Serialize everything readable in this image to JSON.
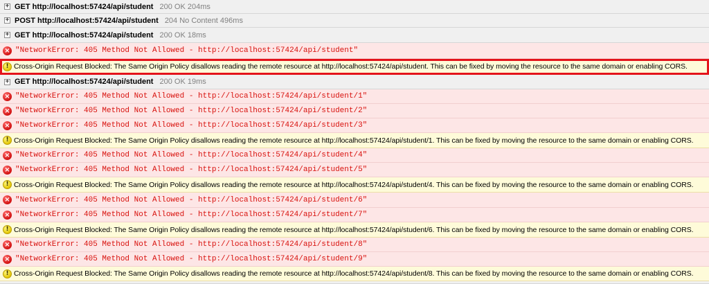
{
  "colors": {
    "network_row_bg": "#f0f0f0",
    "error_row_bg": "#fde6e6",
    "error_text": "#d8100c",
    "warning_row_bg": "#fefbd9",
    "status_text": "#808080",
    "highlight_border": "#e4131b"
  },
  "icons": {
    "network": "expand-plus-icon",
    "error": "error-x-icon",
    "warning": "warning-exclamation-icon"
  },
  "console": {
    "entries": [
      {
        "kind": "network",
        "request": "GET http://localhost:57424/api/student",
        "status": "200 OK 204ms"
      },
      {
        "kind": "network",
        "request": "POST http://localhost:57424/api/student",
        "status": "204 No Content 496ms"
      },
      {
        "kind": "network",
        "request": "GET http://localhost:57424/api/student",
        "status": "200 OK 18ms"
      },
      {
        "kind": "error",
        "message": "\"NetworkError: 405 Method Not Allowed - http://localhost:57424/api/student\""
      },
      {
        "kind": "warning",
        "highlighted": true,
        "message": "Cross-Origin Request Blocked: The Same Origin Policy disallows reading the remote resource at http://localhost:57424/api/student. This can be fixed by moving the resource to the same domain or enabling CORS."
      },
      {
        "kind": "network",
        "request": "GET http://localhost:57424/api/student",
        "status": "200 OK 19ms"
      },
      {
        "kind": "error",
        "message": "\"NetworkError: 405 Method Not Allowed - http://localhost:57424/api/student/1\""
      },
      {
        "kind": "error",
        "message": "\"NetworkError: 405 Method Not Allowed - http://localhost:57424/api/student/2\""
      },
      {
        "kind": "error",
        "message": "\"NetworkError: 405 Method Not Allowed - http://localhost:57424/api/student/3\""
      },
      {
        "kind": "warning",
        "message": "Cross-Origin Request Blocked: The Same Origin Policy disallows reading the remote resource at http://localhost:57424/api/student/1. This can be fixed by moving the resource to the same domain or enabling CORS."
      },
      {
        "kind": "error",
        "message": "\"NetworkError: 405 Method Not Allowed - http://localhost:57424/api/student/4\""
      },
      {
        "kind": "error",
        "message": "\"NetworkError: 405 Method Not Allowed - http://localhost:57424/api/student/5\""
      },
      {
        "kind": "warning",
        "message": "Cross-Origin Request Blocked: The Same Origin Policy disallows reading the remote resource at http://localhost:57424/api/student/4. This can be fixed by moving the resource to the same domain or enabling CORS."
      },
      {
        "kind": "error",
        "message": "\"NetworkError: 405 Method Not Allowed - http://localhost:57424/api/student/6\""
      },
      {
        "kind": "error",
        "message": "\"NetworkError: 405 Method Not Allowed - http://localhost:57424/api/student/7\""
      },
      {
        "kind": "warning",
        "message": "Cross-Origin Request Blocked: The Same Origin Policy disallows reading the remote resource at http://localhost:57424/api/student/6. This can be fixed by moving the resource to the same domain or enabling CORS."
      },
      {
        "kind": "error",
        "message": "\"NetworkError: 405 Method Not Allowed - http://localhost:57424/api/student/8\""
      },
      {
        "kind": "error",
        "message": "\"NetworkError: 405 Method Not Allowed - http://localhost:57424/api/student/9\""
      },
      {
        "kind": "warning",
        "message": "Cross-Origin Request Blocked: The Same Origin Policy disallows reading the remote resource at http://localhost:57424/api/student/8. This can be fixed by moving the resource to the same domain or enabling CORS."
      }
    ]
  }
}
